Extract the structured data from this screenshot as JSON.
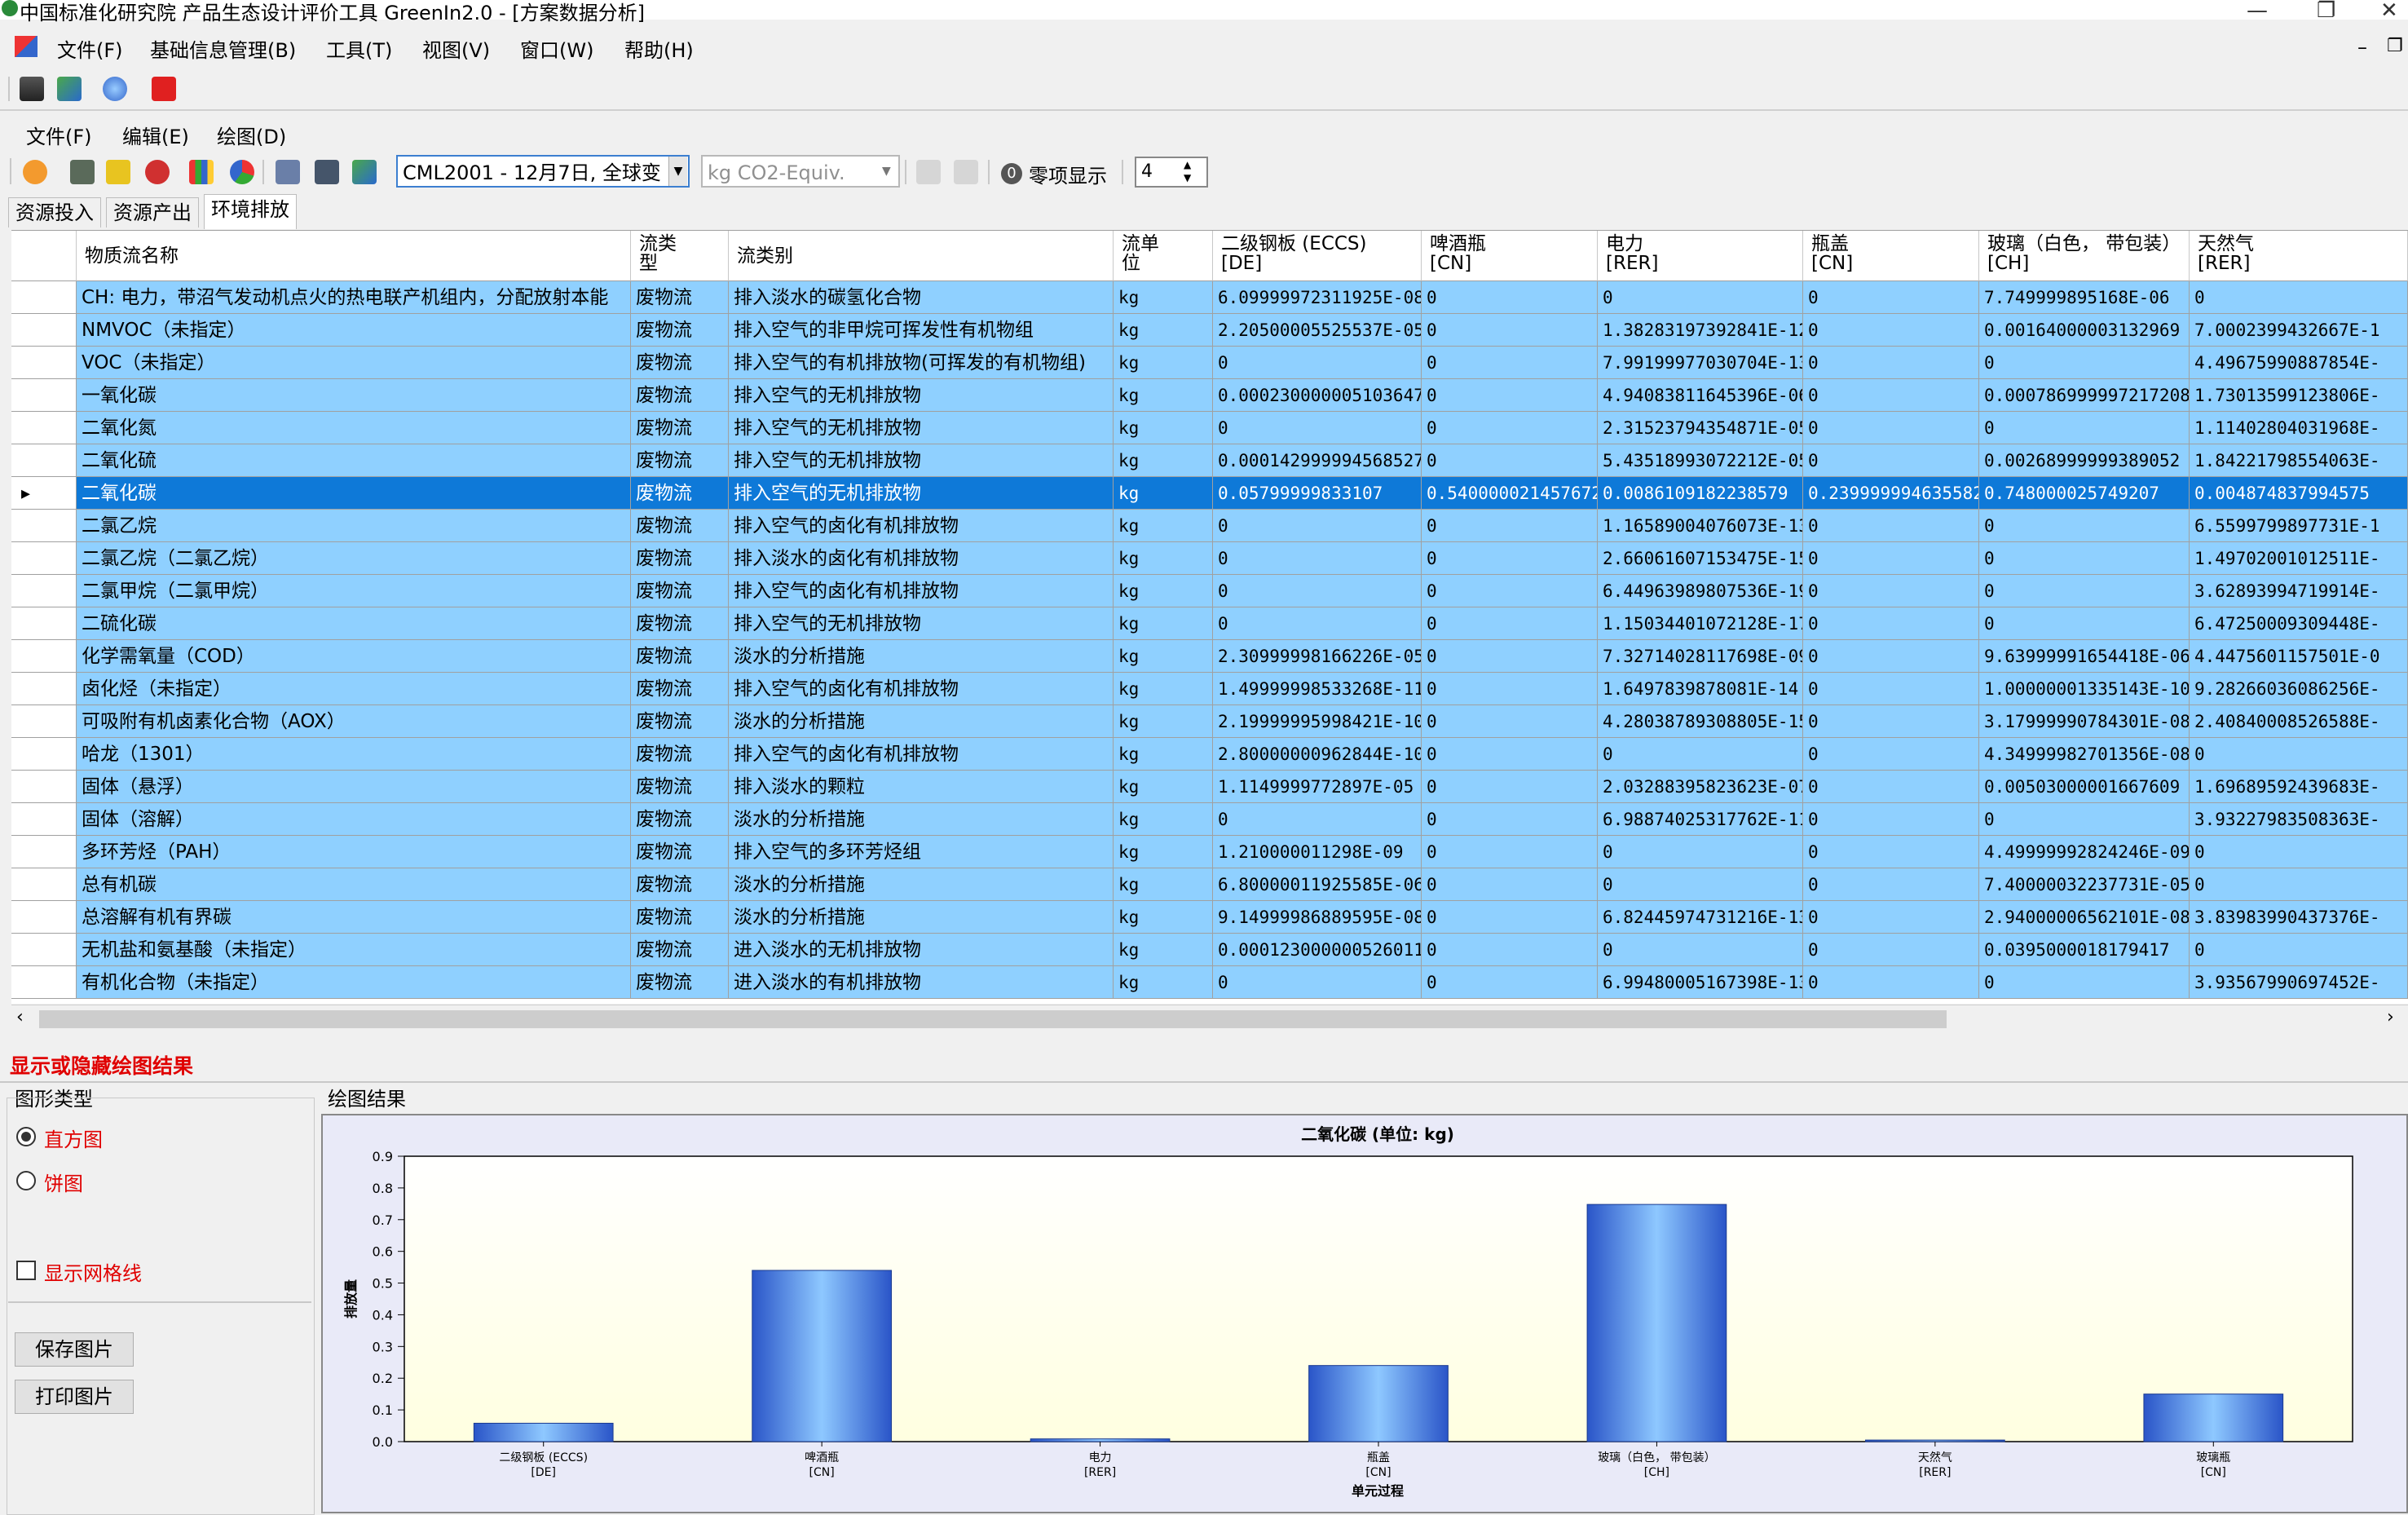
{
  "window": {
    "title": "中国标准化研究院 产品生态设计评价工具 GreenIn2.0 - [方案数据分析]",
    "min_label": "—",
    "max_label": "❐",
    "close_label": "✕",
    "inner_min_label": "–",
    "inner_restore_label": "❐"
  },
  "menubar": {
    "items": [
      "文件(F)",
      "基础信息管理(B)",
      "工具(T)",
      "视图(V)",
      "窗口(W)",
      "帮助(H)"
    ]
  },
  "inner_menu": {
    "items": [
      "文件(F)",
      "编辑(E)",
      "绘图(D)"
    ]
  },
  "toolbar": {
    "method_combo": "CML2001 - 12月7日, 全球变",
    "unit_combo": "kg CO2-Equiv.",
    "zero_label": "零项显示",
    "decimals_value": "4"
  },
  "tabs": [
    "资源投入",
    "资源产出",
    "环境排放"
  ],
  "active_tab": 2,
  "grid": {
    "headers": [
      [
        "物质流名称"
      ],
      [
        "流类",
        "型"
      ],
      [
        "流类别"
      ],
      [
        "流单",
        "位"
      ],
      [
        "二级钢板 (ECCS)",
        "[DE]"
      ],
      [
        "啤酒瓶",
        "[CN]"
      ],
      [
        "电力",
        "[RER]"
      ],
      [
        "瓶盖",
        "[CN]"
      ],
      [
        "玻璃（白色， 带包装）",
        "[CH]"
      ],
      [
        "天然气",
        "[RER]"
      ]
    ],
    "rows": [
      [
        "CH: 电力，带沼气发动机点火的热电联产机组内，分配放射本能",
        "废物流",
        "排入淡水的碳氢化合物",
        "kg",
        "6.09999972311925E-08",
        "0",
        "0",
        "0",
        "7.749999895168E-06",
        "0"
      ],
      [
        "NMVOC（未指定）",
        "废物流",
        "排入空气的非甲烷可挥发性有机物组",
        "kg",
        "2.20500005525537E-05",
        "0",
        "1.38283197392841E-12",
        "0",
        "0.00164000003132969",
        "7.0002399432667E-1"
      ],
      [
        "VOC（未指定）",
        "废物流",
        "排入空气的有机排放物(可挥发的有机物组)",
        "kg",
        "0",
        "0",
        "7.99199977030704E-13",
        "0",
        "0",
        "4.49675990887854E-"
      ],
      [
        "一氧化碳",
        "废物流",
        "排入空气的无机排放物",
        "kg",
        "0.000230000005103647",
        "0",
        "4.94083811645396E-06",
        "0",
        "0.000786999997217208",
        "1.73013599123806E-"
      ],
      [
        "二氧化氮",
        "废物流",
        "排入空气的无机排放物",
        "kg",
        "0",
        "0",
        "2.31523794354871E-05",
        "0",
        "0",
        "1.11402804031968E-"
      ],
      [
        "二氧化硫",
        "废物流",
        "排入空气的无机排放物",
        "kg",
        "0.000142999994568527",
        "0",
        "5.43518993072212E-05",
        "0",
        "0.00268999999389052",
        "1.84221798554063E-"
      ],
      [
        "二氧化碳",
        "废物流",
        "排入空气的无机排放物",
        "kg",
        "0.05799999833107",
        "0.540000021457672",
        "0.0086109182238579",
        "0.239999994635582",
        "0.748000025749207",
        "0.004874837994575"
      ],
      [
        "二氯乙烷",
        "废物流",
        "排入空气的卤化有机排放物",
        "kg",
        "0",
        "0",
        "1.16589004076073E-13",
        "0",
        "0",
        "6.5599799897731E-1"
      ],
      [
        "二氯乙烷（二氯乙烷）",
        "废物流",
        "排入淡水的卤化有机排放物",
        "kg",
        "0",
        "0",
        "2.66061607153475E-15",
        "0",
        "0",
        "1.49702001012511E-"
      ],
      [
        "二氯甲烷（二氯甲烷）",
        "废物流",
        "排入空气的卤化有机排放物",
        "kg",
        "0",
        "0",
        "6.44963989807536E-19",
        "0",
        "0",
        "3.62893994719914E-"
      ],
      [
        "二硫化碳",
        "废物流",
        "排入空气的无机排放物",
        "kg",
        "0",
        "0",
        "1.15034401072128E-17",
        "0",
        "0",
        "6.47250009309448E-"
      ],
      [
        "化学需氧量（COD）",
        "废物流",
        "淡水的分析措施",
        "kg",
        "2.30999998166226E-05",
        "0",
        "7.32714028117698E-09",
        "0",
        "9.63999991654418E-06",
        "4.4475601157501E-0"
      ],
      [
        "卤化烃（未指定）",
        "废物流",
        "排入空气的卤化有机排放物",
        "kg",
        "1.49999998533268E-11",
        "0",
        "1.6497839878081E-14",
        "0",
        "1.00000001335143E-10",
        "9.28266036086256E-"
      ],
      [
        "可吸附有机卤素化合物（AOX）",
        "废物流",
        "淡水的分析措施",
        "kg",
        "2.19999995998421E-10",
        "0",
        "4.28038789308805E-15",
        "0",
        "3.17999990784301E-08",
        "2.40840008526588E-"
      ],
      [
        "哈龙（1301）",
        "废物流",
        "排入空气的卤化有机排放物",
        "kg",
        "2.80000000962844E-10",
        "0",
        "0",
        "0",
        "4.34999982701356E-08",
        "0"
      ],
      [
        "固体（悬浮）",
        "废物流",
        "排入淡水的颗粒",
        "kg",
        "1.1149999772897E-05",
        "0",
        "2.03288395823623E-07",
        "0",
        "0.00503000001667609",
        "1.69689592439683E-"
      ],
      [
        "固体（溶解）",
        "废物流",
        "淡水的分析措施",
        "kg",
        "0",
        "0",
        "6.98874025317762E-11",
        "0",
        "0",
        "3.93227983508363E-"
      ],
      [
        "多环芳烃（PAH）",
        "废物流",
        "排入空气的多环芳烃组",
        "kg",
        "1.210000011298E-09",
        "0",
        "0",
        "0",
        "4.49999992824246E-09",
        "0"
      ],
      [
        "总有机碳",
        "废物流",
        "淡水的分析措施",
        "kg",
        "6.80000011925585E-06",
        "0",
        "0",
        "0",
        "7.40000032237731E-05",
        "0"
      ],
      [
        "总溶解有机有界碳",
        "废物流",
        "淡水的分析措施",
        "kg",
        "9.14999986889595E-08",
        "0",
        "6.82445974731216E-13",
        "0",
        "2.94000006562101E-08",
        "3.83983990437376E-"
      ],
      [
        "无机盐和氨基酸（未指定）",
        "废物流",
        "进入淡水的无机排放物",
        "kg",
        "0.000123000000526011",
        "0",
        "0",
        "0",
        "0.0395000018179417",
        "0"
      ],
      [
        "有机化合物（未指定）",
        "废物流",
        "进入淡水的有机排放物",
        "kg",
        "0",
        "0",
        "6.99480005167398E-13",
        "0",
        "0",
        "3.93567990697452E-"
      ]
    ],
    "selected_row": 6
  },
  "plot_panel": {
    "toggle_label": "显示或隐藏绘图结果",
    "type_group_label": "图形类型",
    "radio_bar": "直方图",
    "radio_pie": "饼图",
    "gridlines_label": "显示网格线",
    "save_button": "保存图片",
    "print_button": "打印图片",
    "result_label": "绘图结果"
  },
  "chart_data": {
    "type": "bar",
    "title": "二氧化碳 (单位: kg)",
    "xlabel": "单元过程",
    "ylabel": "排放量",
    "ylim": [
      0,
      0.9
    ],
    "yticks": [
      "0.0",
      "0.1",
      "0.2",
      "0.3",
      "0.4",
      "0.5",
      "0.6",
      "0.7",
      "0.8",
      "0.9"
    ],
    "categories": [
      [
        "二级钢板 (ECCS)",
        "[DE]"
      ],
      [
        "啤酒瓶",
        "[CN]"
      ],
      [
        "电力",
        "[RER]"
      ],
      [
        "瓶盖",
        "[CN]"
      ],
      [
        "玻璃（白色， 带包装）",
        "[CH]"
      ],
      [
        "天然气",
        "[RER]"
      ],
      [
        "玻璃瓶",
        "[CN]"
      ]
    ],
    "values": [
      0.058,
      0.54,
      0.0086,
      0.24,
      0.748,
      0.0049,
      0.15
    ],
    "bar_color": "#3f7fe6",
    "plot_bg": "#ffffe6",
    "grid": false
  }
}
